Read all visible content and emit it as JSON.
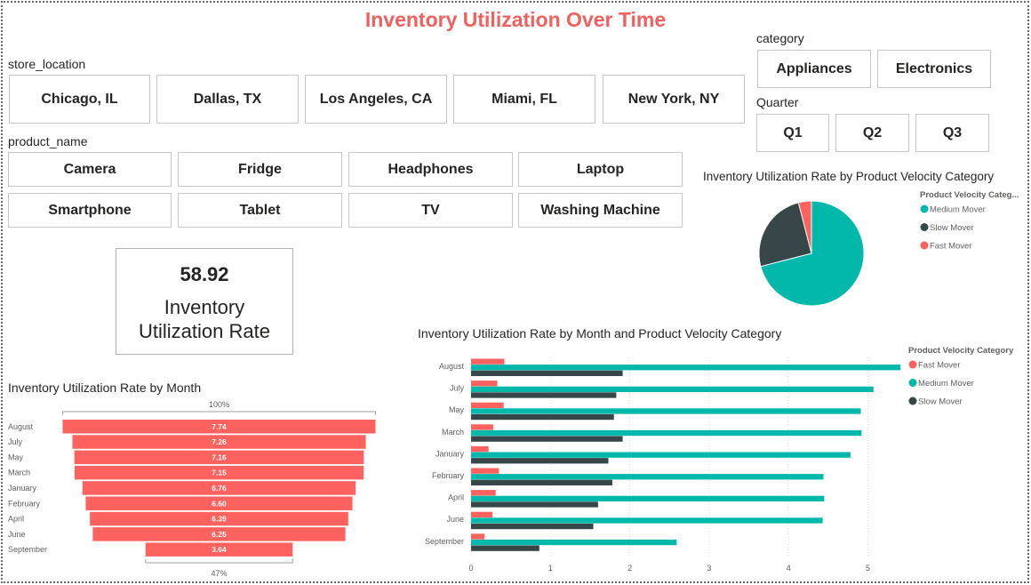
{
  "title": "Inventory Utilization Over Time",
  "colors": {
    "fast": "#fd625e",
    "medium": "#01b8aa",
    "slow": "#374649",
    "title": "#f0605f"
  },
  "store_slicer": {
    "label": "store_location",
    "items": [
      "Chicago, IL",
      "Dallas, TX",
      "Los Angeles, CA",
      "Miami, FL",
      "New York, NY"
    ]
  },
  "product_slicer": {
    "label": "product_name",
    "items": [
      "Camera",
      "Fridge",
      "Headphones",
      "Laptop",
      "Smartphone",
      "Tablet",
      "TV",
      "Washing Machine"
    ]
  },
  "category_slicer": {
    "label": "category",
    "items": [
      "Appliances",
      "Electronics"
    ]
  },
  "quarter_slicer": {
    "label": "Quarter",
    "items": [
      "Q1",
      "Q2",
      "Q3"
    ]
  },
  "kpi": {
    "value": "58.92",
    "label": "Inventory\nUtilization Rate"
  },
  "chart_data": [
    {
      "type": "pie",
      "title": "Inventory Utilization Rate by Product Velocity Category",
      "legend_title": "Product Velocity Categ...",
      "legend_position": "right",
      "slices": [
        {
          "name": "Medium Mover",
          "value": 71
        },
        {
          "name": "Slow Mover",
          "value": 25
        },
        {
          "name": "Fast Mover",
          "value": 4
        }
      ]
    },
    {
      "type": "bar",
      "orientation": "horizontal",
      "variant": "funnel",
      "title": "Inventory Utilization Rate by Month",
      "categories": [
        "August",
        "July",
        "May",
        "March",
        "January",
        "February",
        "April",
        "June",
        "September"
      ],
      "values": [
        7.74,
        7.26,
        7.16,
        7.15,
        6.76,
        6.6,
        6.39,
        6.25,
        3.64
      ],
      "labels": [
        "7.74",
        "7.26",
        "7.16",
        "7.15",
        "6.76",
        "6.60",
        "6.39",
        "6.25",
        "3.64"
      ],
      "top_percent": "100%",
      "bottom_percent": "47%"
    },
    {
      "type": "bar",
      "orientation": "horizontal",
      "title": "Inventory Utilization Rate by Month and Product Velocity Category",
      "legend_title": "Product Velocity Category",
      "legend_position": "right",
      "categories": [
        "August",
        "July",
        "May",
        "March",
        "January",
        "February",
        "April",
        "June",
        "September"
      ],
      "xlim": [
        0,
        5.5
      ],
      "ticks": [
        "0",
        "1",
        "2",
        "3",
        "4",
        "5"
      ],
      "grid": true,
      "series": [
        {
          "name": "Fast Mover",
          "values": [
            0.42,
            0.33,
            0.41,
            0.28,
            0.22,
            0.35,
            0.31,
            0.27,
            0.17
          ]
        },
        {
          "name": "Medium Mover",
          "values": [
            5.41,
            5.07,
            4.91,
            4.92,
            4.78,
            4.44,
            4.45,
            4.43,
            2.59
          ]
        },
        {
          "name": "Slow Mover",
          "values": [
            1.91,
            1.83,
            1.8,
            1.91,
            1.73,
            1.78,
            1.6,
            1.54,
            0.86
          ]
        }
      ]
    }
  ]
}
